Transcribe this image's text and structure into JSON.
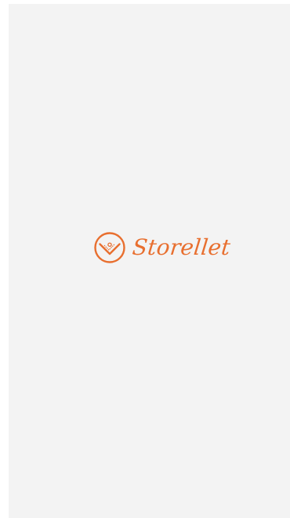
{
  "splash": {
    "brand_name": "Storellet",
    "logo_icon": "storellet-logo-icon",
    "brand_color": "#e86f2f",
    "background_color": "#f3f3f3"
  }
}
